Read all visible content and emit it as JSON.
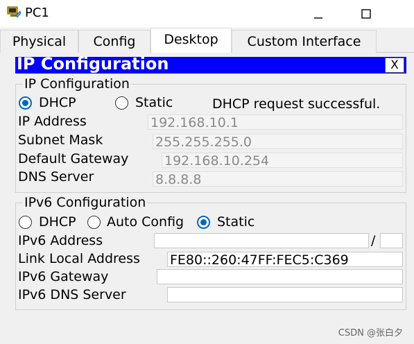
{
  "window": {
    "title": "PC1",
    "app_icon": "network-pc-icon",
    "minimize_icon": "minimize-icon",
    "maximize_icon": "maximize-icon"
  },
  "tabs": [
    {
      "label": "Physical",
      "active": false
    },
    {
      "label": "Config",
      "active": false
    },
    {
      "label": "Desktop",
      "active": true
    },
    {
      "label": "Custom Interface",
      "active": false
    }
  ],
  "panel": {
    "title": "IP Configuration",
    "close_label": "X"
  },
  "ipv4": {
    "legend": "IP Configuration",
    "dhcp_label": "DHCP",
    "dhcp_selected": true,
    "static_label": "Static",
    "static_selected": false,
    "status": "DHCP request successful.",
    "rows": [
      {
        "label": "IP Address",
        "value": "192.168.10.1"
      },
      {
        "label": "Subnet Mask",
        "value": "255.255.255.0"
      },
      {
        "label": "Default Gateway",
        "value": "192.168.10.254"
      },
      {
        "label": "DNS Server",
        "value": "8.8.8.8"
      }
    ]
  },
  "ipv6": {
    "legend": "IPv6 Configuration",
    "dhcp_label": "DHCP",
    "dhcp_selected": false,
    "auto_label": "Auto Config",
    "auto_selected": false,
    "static_label": "Static",
    "static_selected": true,
    "address_label": "IPv6 Address",
    "address_value": "",
    "prefix_separator": "/",
    "prefix_value": "",
    "link_local_label": "Link Local Address",
    "link_local_value": "FE80::260:47FF:FEC5:C369",
    "gateway_label": "IPv6 Gateway",
    "gateway_value": "",
    "dns_label": "IPv6 DNS Server",
    "dns_value": ""
  },
  "watermark": "CSDN @张白夕",
  "colors": {
    "header_bg": "#0000ff",
    "radio_selected": "#0067c0",
    "content_bg": "#f0f0f0"
  }
}
